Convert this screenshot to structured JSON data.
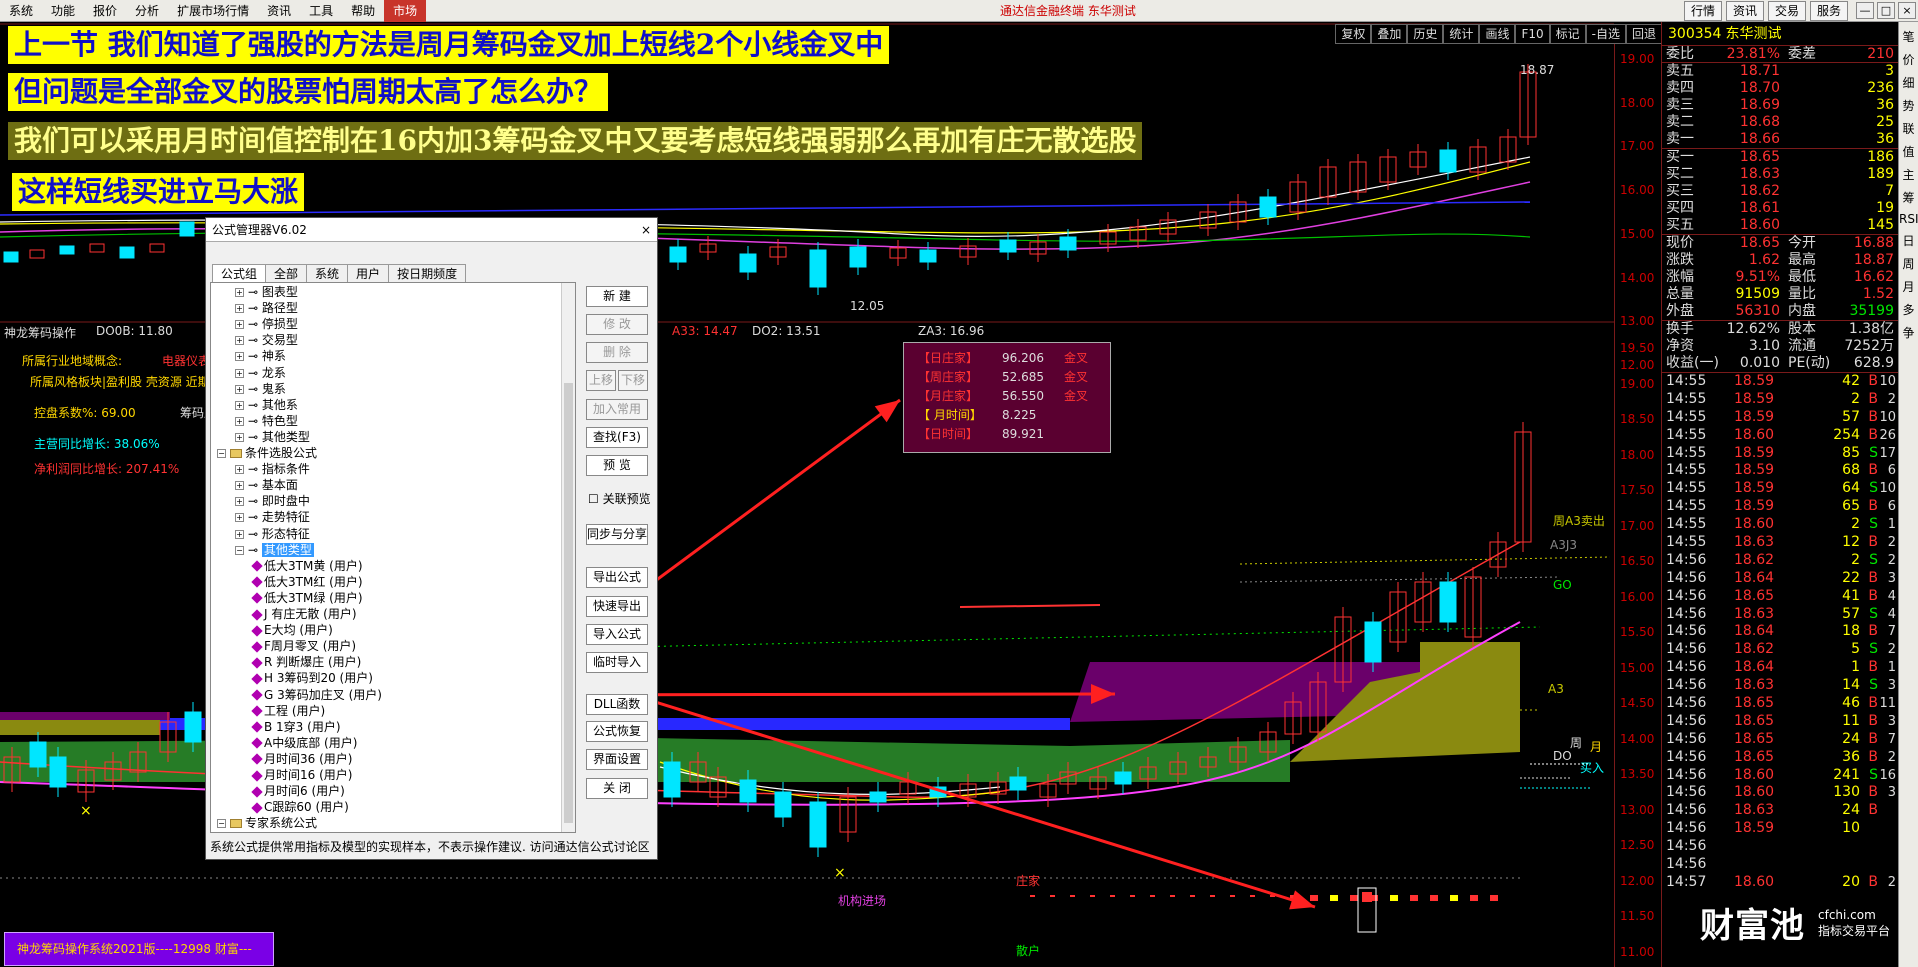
{
  "menubar": {
    "items": [
      "系统",
      "功能",
      "报价",
      "分析",
      "扩展市场行情",
      "资讯",
      "工具",
      "帮助",
      "市场"
    ],
    "center_title": "通达信金融终端  东华测试",
    "right_buttons": [
      "行情",
      "资讯",
      "交易",
      "服务"
    ],
    "window_controls": [
      "—",
      "□",
      "×"
    ]
  },
  "toolbar": {
    "buttons": [
      "复权",
      "叠加",
      "历史",
      "统计",
      "画线",
      "F10",
      "标记",
      "-自选",
      "回退"
    ]
  },
  "banners": [
    "上一节  我们知道了强股的方法是周月筹码金叉加上短线2个小线金叉中",
    "但问题是全部金叉的股票怕周期太高了怎么办？",
    "我们可以采用月时间值控制在16内加3筹码金叉中又要考虑短线强弱那么再加有庄无散选股",
    "这样短线买进立马大涨"
  ],
  "main_chart": {
    "high_label": "18.87",
    "low_label": "12.05",
    "price_ticks": [
      "19.00",
      "18.00",
      "17.00",
      "16.00",
      "15.00",
      "14.00",
      "13.00",
      "12.00"
    ]
  },
  "indicator": {
    "title": "神龙筹码操作",
    "do0b": "DO0B: 11.80",
    "a33": "A33: 14.47",
    "do2": "DO2: 13.51",
    "za3": "ZA3: 16.96",
    "industry_label": "所属行业地域概念:",
    "industry_value": "电器仪表",
    "industry_detail": "所属风格板块|盈利股 壳资源 近期强",
    "control_label": "控盘系数%: 69.00",
    "chip_label": "筹码成",
    "revenue_label": "主营同比增长: 38.06%",
    "profit_label": "净利润同比增长: 207.41%",
    "side_labels": {
      "sell": "周A3卖出",
      "a3j3": "A3J3",
      "go": "GO",
      "a3": "A3",
      "week": "周",
      "month": "月",
      "do": "DO",
      "buy": "买入",
      "zhuang": "庄家",
      "institution": "机构进场",
      "retail": "散户"
    },
    "price_ticks": [
      "19.50",
      "19.00",
      "18.50",
      "18.00",
      "17.50",
      "17.00",
      "16.50",
      "16.00",
      "15.50",
      "15.00",
      "14.50",
      "14.00",
      "13.50",
      "13.00",
      "12.50",
      "12.00",
      "11.50",
      "11.00"
    ]
  },
  "infobox": {
    "rows": [
      {
        "name": "【日庄家】",
        "value": "96.206",
        "status": "金叉"
      },
      {
        "name": "【周庄家】",
        "value": "52.685",
        "status": "金叉"
      },
      {
        "name": "【月庄家】",
        "value": "56.550",
        "status": "金叉"
      },
      {
        "name": "【 月时间】",
        "value": "8.225",
        "status": ""
      },
      {
        "name": "【日时间】",
        "value": "89.921",
        "status": ""
      }
    ]
  },
  "dialog": {
    "title": "公式管理器V6.02",
    "close": "×",
    "tabs": [
      "公式组",
      "全部",
      "系统",
      "用户",
      "按日期频度"
    ],
    "tree": [
      {
        "indent": 1,
        "kind": "leaf",
        "text": "图表型"
      },
      {
        "indent": 1,
        "kind": "leaf",
        "text": "路径型"
      },
      {
        "indent": 1,
        "kind": "leaf",
        "text": "停损型"
      },
      {
        "indent": 1,
        "kind": "leaf",
        "text": "交易型"
      },
      {
        "indent": 1,
        "kind": "leaf",
        "text": "神系"
      },
      {
        "indent": 1,
        "kind": "leaf",
        "text": "龙系"
      },
      {
        "indent": 1,
        "kind": "leaf",
        "text": "鬼系"
      },
      {
        "indent": 1,
        "kind": "leaf",
        "text": "其他系"
      },
      {
        "indent": 1,
        "kind": "leaf",
        "text": "特色型"
      },
      {
        "indent": 1,
        "kind": "leaf",
        "text": "其他类型"
      },
      {
        "indent": 0,
        "kind": "folder",
        "text": "条件选股公式"
      },
      {
        "indent": 1,
        "kind": "leaf",
        "text": "指标条件"
      },
      {
        "indent": 1,
        "kind": "leaf",
        "text": "基本面"
      },
      {
        "indent": 1,
        "kind": "leaf",
        "text": "即时盘中"
      },
      {
        "indent": 1,
        "kind": "leaf",
        "text": "走势特征"
      },
      {
        "indent": 1,
        "kind": "leaf",
        "text": "形态特征"
      },
      {
        "indent": 1,
        "kind": "selected",
        "text": "其他类型"
      },
      {
        "indent": 2,
        "kind": "formula",
        "text": "低大3TM黄   (用户)"
      },
      {
        "indent": 2,
        "kind": "formula",
        "text": "低大3TM红   (用户)"
      },
      {
        "indent": 2,
        "kind": "formula",
        "text": "低大3TM绿   (用户)"
      },
      {
        "indent": 2,
        "kind": "formula",
        "text": "J  有庄无散    (用户)"
      },
      {
        "indent": 2,
        "kind": "formula",
        "text": "E大均    (用户)"
      },
      {
        "indent": 2,
        "kind": "formula",
        "text": "F周月零叉    (用户)"
      },
      {
        "indent": 2,
        "kind": "formula",
        "text": "R  判断爆庄    (用户)"
      },
      {
        "indent": 2,
        "kind": "formula",
        "text": "H 3筹码到20   (用户)"
      },
      {
        "indent": 2,
        "kind": "formula",
        "text": "G 3筹码加庄叉    (用户)"
      },
      {
        "indent": 2,
        "kind": "formula",
        "text": "工程    (用户)"
      },
      {
        "indent": 2,
        "kind": "formula",
        "text": "B  1穿3    (用户)"
      },
      {
        "indent": 2,
        "kind": "formula",
        "text": "A中级底部    (用户)"
      },
      {
        "indent": 2,
        "kind": "formula",
        "text": "月时间36    (用户)"
      },
      {
        "indent": 2,
        "kind": "formula",
        "text": "月时间16    (用户)"
      },
      {
        "indent": 2,
        "kind": "formula",
        "text": "月时间6    (用户)"
      },
      {
        "indent": 2,
        "kind": "formula",
        "text": "C跟踪60    (用户)"
      },
      {
        "indent": 0,
        "kind": "folder",
        "text": "专家系统公式"
      }
    ],
    "buttons": [
      {
        "label": "新  建",
        "enabled": true
      },
      {
        "label": "修  改",
        "enabled": false
      },
      {
        "label": "删  除",
        "enabled": false
      },
      {
        "label": "上移",
        "enabled": false
      },
      {
        "label": "加入常用",
        "enabled": false
      },
      {
        "label": "查找(F3)",
        "enabled": true
      },
      {
        "label": "预  览",
        "enabled": true
      },
      {
        "label": "同步与分享",
        "enabled": true
      },
      {
        "label": "导出公式",
        "enabled": true
      },
      {
        "label": "快速导出",
        "enabled": true
      },
      {
        "label": "导入公式",
        "enabled": true
      },
      {
        "label": "临时导入",
        "enabled": true
      },
      {
        "label": "DLL函数",
        "enabled": true
      },
      {
        "label": "公式恢复",
        "enabled": true
      },
      {
        "label": "界面设置",
        "enabled": true
      },
      {
        "label": "关  闭",
        "enabled": true
      }
    ],
    "down_button": "下移",
    "checkbox_label": "关联预览",
    "footer": "系统公式提供常用指标及模型的实现样本，不表示操作建议.  访问通达信公式讨论区"
  },
  "quote": {
    "code": "300354",
    "name": "东华测试",
    "committee": {
      "label": "委比",
      "value": "23.81%",
      "label2": "委差",
      "value2": "210"
    },
    "asks": [
      {
        "label": "卖五",
        "price": "18.71",
        "vol": "3"
      },
      {
        "label": "卖四",
        "price": "18.70",
        "vol": "236"
      },
      {
        "label": "卖三",
        "price": "18.69",
        "vol": "36"
      },
      {
        "label": "卖二",
        "price": "18.68",
        "vol": "25"
      },
      {
        "label": "卖一",
        "price": "18.66",
        "vol": "36"
      }
    ],
    "bids": [
      {
        "label": "买一",
        "price": "18.65",
        "vol": "186"
      },
      {
        "label": "买二",
        "price": "18.63",
        "vol": "189"
      },
      {
        "label": "买三",
        "price": "18.62",
        "vol": "7"
      },
      {
        "label": "买四",
        "price": "18.61",
        "vol": "19"
      },
      {
        "label": "买五",
        "price": "18.60",
        "vol": "145"
      }
    ],
    "stats": [
      {
        "a": "现价",
        "b": "18.65",
        "c": "今开",
        "d": "16.88",
        "bc": "red",
        "dc": "red"
      },
      {
        "a": "涨跌",
        "b": "1.62",
        "c": "最高",
        "d": "18.87",
        "bc": "red",
        "dc": "red"
      },
      {
        "a": "涨幅",
        "b": "9.51%",
        "c": "最低",
        "d": "16.62",
        "bc": "red",
        "dc": "red"
      },
      {
        "a": "总量",
        "b": "91509",
        "c": "量比",
        "d": "1.52",
        "bc": "yel",
        "dc": "red"
      },
      {
        "a": "外盘",
        "b": "56310",
        "c": "内盘",
        "d": "35199",
        "bc": "red",
        "dc": "grn"
      }
    ],
    "stats2": [
      {
        "a": "换手",
        "b": "12.62%",
        "c": "股本",
        "d": "1.38亿"
      },
      {
        "a": "净资",
        "b": "3.10",
        "c": "流通",
        "d": "7252万"
      },
      {
        "a": "收益(一)",
        "b": "0.010",
        "c": "PE(动)",
        "d": "628.9"
      }
    ],
    "ticks": [
      {
        "t": "14:55",
        "p": "18.59",
        "v": "42",
        "s": "B",
        "n": "10",
        "sc": "red"
      },
      {
        "t": "14:55",
        "p": "18.59",
        "v": "2",
        "s": "B",
        "n": "2",
        "sc": "red"
      },
      {
        "t": "14:55",
        "p": "18.59",
        "v": "57",
        "s": "B",
        "n": "10",
        "sc": "red"
      },
      {
        "t": "14:55",
        "p": "18.60",
        "v": "254",
        "s": "B",
        "n": "26",
        "sc": "red"
      },
      {
        "t": "14:55",
        "p": "18.59",
        "v": "85",
        "s": "S",
        "n": "17",
        "sc": "grn"
      },
      {
        "t": "14:55",
        "p": "18.59",
        "v": "68",
        "b": "",
        "s": "B",
        "n": "6",
        "sc": "red"
      },
      {
        "t": "14:55",
        "p": "18.59",
        "v": "64",
        "s": "S",
        "n": "10",
        "sc": "grn"
      },
      {
        "t": "14:55",
        "p": "18.59",
        "v": "65",
        "s": "B",
        "n": "6",
        "sc": "red"
      },
      {
        "t": "14:55",
        "p": "18.60",
        "v": "2",
        "s": "S",
        "n": "1",
        "sc": "grn"
      },
      {
        "t": "14:55",
        "p": "18.63",
        "v": "12",
        "s": "B",
        "n": "2",
        "sc": "red"
      },
      {
        "t": "14:56",
        "p": "18.62",
        "v": "2",
        "s": "S",
        "n": "2",
        "sc": "grn"
      },
      {
        "t": "14:56",
        "p": "18.64",
        "v": "22",
        "s": "B",
        "n": "3",
        "sc": "red"
      },
      {
        "t": "14:56",
        "p": "18.65",
        "v": "41",
        "s": "B",
        "n": "4",
        "sc": "red"
      },
      {
        "t": "14:56",
        "p": "18.63",
        "v": "57",
        "s": "S",
        "n": "4",
        "sc": "grn"
      },
      {
        "t": "14:56",
        "p": "18.64",
        "v": "18",
        "s": "B",
        "n": "7",
        "sc": "red"
      },
      {
        "t": "14:56",
        "p": "18.62",
        "v": "5",
        "s": "S",
        "n": "2",
        "sc": "grn"
      },
      {
        "t": "14:56",
        "p": "18.64",
        "v": "1",
        "s": "B",
        "n": "1",
        "sc": "red"
      },
      {
        "t": "14:56",
        "p": "18.63",
        "v": "14",
        "s": "S",
        "n": "3",
        "sc": "grn"
      },
      {
        "t": "14:56",
        "p": "18.65",
        "v": "46",
        "s": "B",
        "n": "11",
        "sc": "red"
      },
      {
        "t": "14:56",
        "p": "18.65",
        "v": "11",
        "s": "B",
        "n": "3",
        "sc": "red"
      },
      {
        "t": "14:56",
        "p": "18.65",
        "v": "24",
        "s": "B",
        "n": "7",
        "sc": "red"
      },
      {
        "t": "14:56",
        "p": "18.65",
        "v": "36",
        "s": "B",
        "n": "2",
        "sc": "red"
      },
      {
        "t": "14:56",
        "p": "18.60",
        "v": "241",
        "s": "S",
        "n": "16",
        "sc": "grn"
      },
      {
        "t": "14:56",
        "p": "18.60",
        "v": "130",
        "s": "B",
        "n": "3",
        "sc": "red"
      },
      {
        "t": "14:56",
        "p": "18.63",
        "v": "24",
        "s": "B",
        "n": "",
        "sc": "red"
      },
      {
        "t": "14:56",
        "p": "18.59",
        "v": "10",
        "s": "",
        "n": "",
        "sc": "red"
      },
      {
        "t": "14:56",
        "p": "",
        "v": "",
        "s": "",
        "n": "",
        "sc": "red"
      },
      {
        "t": "14:56",
        "p": "",
        "v": "",
        "s": "",
        "n": "",
        "sc": "red"
      },
      {
        "t": "14:57",
        "p": "18.60",
        "v": "20",
        "s": "B",
        "n": "2",
        "sc": "red"
      }
    ],
    "vtabs": [
      "笔",
      "价",
      "细",
      "势",
      "联",
      "值",
      "主",
      "筹",
      "RSI",
      "日",
      "周",
      "月",
      "多",
      "争"
    ]
  },
  "status": {
    "system_label": "神龙筹码操作系统2021版----12998 财富---",
    "logo": "财富池",
    "logo_url": "cfchi.com",
    "logo_sub": "指标交易平台"
  }
}
